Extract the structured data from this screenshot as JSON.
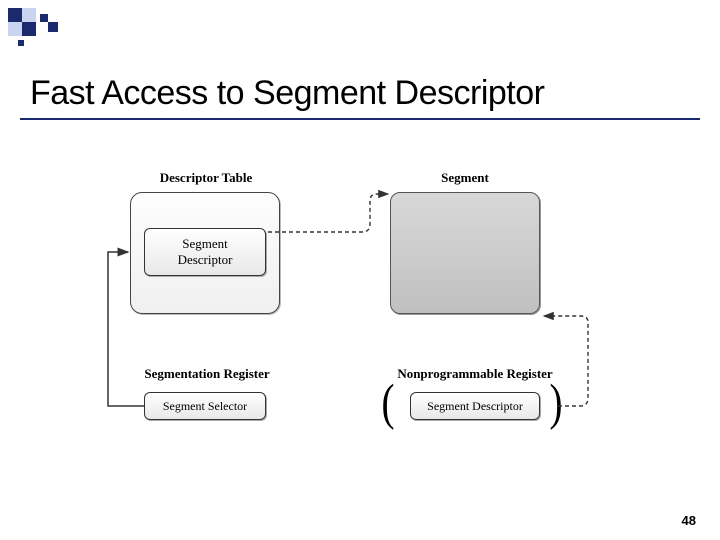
{
  "title": "Fast Access to Segment Descriptor",
  "labels": {
    "descriptor_table": "Descriptor Table",
    "segment": "Segment",
    "segmentation_register": "Segmentation Register",
    "nonprogrammable_register": "Nonprogrammable Register"
  },
  "boxes": {
    "segment_descriptor": "Segment\nDescriptor",
    "segment_selector": "Segment Selector",
    "segment_descriptor2": "Segment Descriptor"
  },
  "page_number": "48"
}
